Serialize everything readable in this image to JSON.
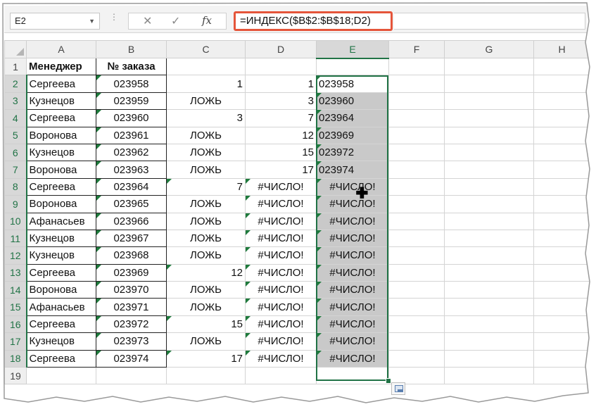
{
  "formula_bar": {
    "name_box": "E2",
    "cancel_icon": "✕",
    "enter_icon": "✓",
    "fx_label": "fx",
    "formula": "=ИНДЕКС($B$2:$B$18;D2)"
  },
  "columns": [
    "A",
    "B",
    "C",
    "D",
    "E",
    "F",
    "G",
    "H"
  ],
  "rows": [
    {
      "n": "1",
      "a": "Менеджер",
      "b": "№ заказа",
      "c": "",
      "d": "",
      "e": ""
    },
    {
      "n": "2",
      "a": "Сергеева",
      "b": "023958",
      "c": "1",
      "d": "1",
      "e": "023958"
    },
    {
      "n": "3",
      "a": "Кузнецов",
      "b": "023959",
      "c": "ЛОЖЬ",
      "d": "3",
      "e": "023960"
    },
    {
      "n": "4",
      "a": "Сергеева",
      "b": "023960",
      "c": "3",
      "d": "7",
      "e": "023964"
    },
    {
      "n": "5",
      "a": "Воронова",
      "b": "023961",
      "c": "ЛОЖЬ",
      "d": "12",
      "e": "023969"
    },
    {
      "n": "6",
      "a": "Кузнецов",
      "b": "023962",
      "c": "ЛОЖЬ",
      "d": "15",
      "e": "023972"
    },
    {
      "n": "7",
      "a": "Воронова",
      "b": "023963",
      "c": "ЛОЖЬ",
      "d": "17",
      "e": "023974"
    },
    {
      "n": "8",
      "a": "Сергеева",
      "b": "023964",
      "c": "7",
      "d": "#ЧИСЛО!",
      "e": "#ЧИСЛО!"
    },
    {
      "n": "9",
      "a": "Воронова",
      "b": "023965",
      "c": "ЛОЖЬ",
      "d": "#ЧИСЛО!",
      "e": "#ЧИСЛО!"
    },
    {
      "n": "10",
      "a": "Афанасьев",
      "b": "023966",
      "c": "ЛОЖЬ",
      "d": "#ЧИСЛО!",
      "e": "#ЧИСЛО!"
    },
    {
      "n": "11",
      "a": "Кузнецов",
      "b": "023967",
      "c": "ЛОЖЬ",
      "d": "#ЧИСЛО!",
      "e": "#ЧИСЛО!"
    },
    {
      "n": "12",
      "a": "Кузнецов",
      "b": "023968",
      "c": "ЛОЖЬ",
      "d": "#ЧИСЛО!",
      "e": "#ЧИСЛО!"
    },
    {
      "n": "13",
      "a": "Сергеева",
      "b": "023969",
      "c": "12",
      "d": "#ЧИСЛО!",
      "e": "#ЧИСЛО!"
    },
    {
      "n": "14",
      "a": "Воронова",
      "b": "023970",
      "c": "ЛОЖЬ",
      "d": "#ЧИСЛО!",
      "e": "#ЧИСЛО!"
    },
    {
      "n": "15",
      "a": "Афанасьев",
      "b": "023971",
      "c": "ЛОЖЬ",
      "d": "#ЧИСЛО!",
      "e": "#ЧИСЛО!"
    },
    {
      "n": "16",
      "a": "Сергеева",
      "b": "023972",
      "c": "15",
      "d": "#ЧИСЛО!",
      "e": "#ЧИСЛО!"
    },
    {
      "n": "17",
      "a": "Кузнецов",
      "b": "023973",
      "c": "ЛОЖЬ",
      "d": "#ЧИСЛО!",
      "e": "#ЧИСЛО!"
    },
    {
      "n": "18",
      "a": "Сергеева",
      "b": "023974",
      "c": "17",
      "d": "#ЧИСЛО!",
      "e": "#ЧИСЛО!"
    },
    {
      "n": "19",
      "a": "",
      "b": "",
      "c": "",
      "d": "",
      "e": ""
    }
  ],
  "colors": {
    "formula_highlight": "#e5553a",
    "selection": "#217346",
    "error_indicator": "#1e7a3c"
  },
  "icons": {
    "fill_handle": "fill-handle-icon",
    "quick_analysis": "quick-analysis-icon",
    "cursor": "cell-cursor-icon"
  }
}
